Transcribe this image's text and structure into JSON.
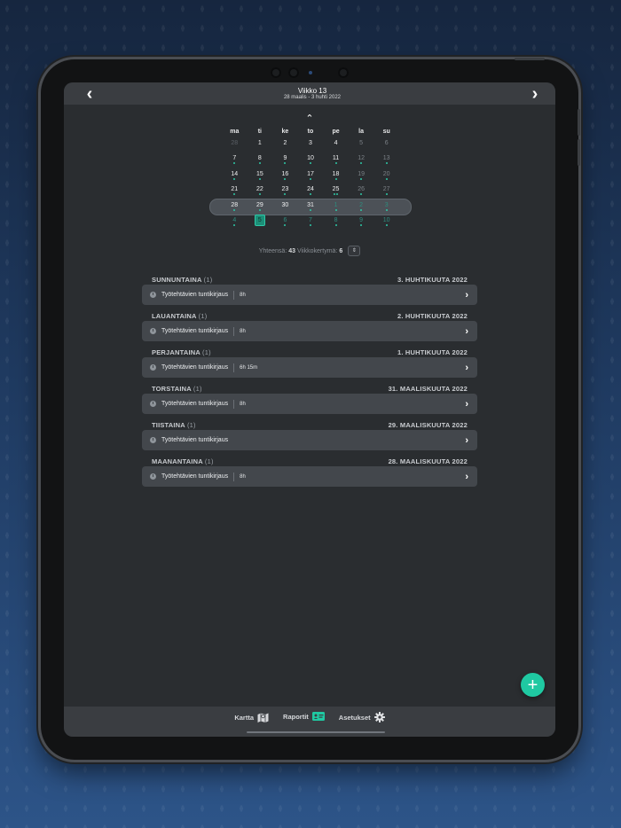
{
  "header": {
    "prev_icon": "chevron-left-icon",
    "next_icon": "chevron-right-icon",
    "prev_glyph": "‹",
    "next_glyph": "›",
    "week_title": "Viikko 13",
    "date_range": "28 maalis - 3 huhti 2022"
  },
  "calendar": {
    "collapse_glyph": "⌃",
    "weekdays": [
      "ma",
      "ti",
      "ke",
      "to",
      "pe",
      "la",
      "su"
    ],
    "weeks": [
      {
        "selected": false,
        "days": [
          {
            "d": "28",
            "s": "faded",
            "dots": 0
          },
          {
            "d": "1",
            "s": "",
            "dots": 0
          },
          {
            "d": "2",
            "s": "",
            "dots": 0
          },
          {
            "d": "3",
            "s": "",
            "dots": 0
          },
          {
            "d": "4",
            "s": "",
            "dots": 0
          },
          {
            "d": "5",
            "s": "weekend",
            "dots": 0
          },
          {
            "d": "6",
            "s": "weekend",
            "dots": 0
          }
        ]
      },
      {
        "selected": false,
        "days": [
          {
            "d": "7",
            "s": "",
            "dots": 1
          },
          {
            "d": "8",
            "s": "",
            "dots": 1
          },
          {
            "d": "9",
            "s": "",
            "dots": 1
          },
          {
            "d": "10",
            "s": "",
            "dots": 1
          },
          {
            "d": "11",
            "s": "",
            "dots": 1
          },
          {
            "d": "12",
            "s": "weekend",
            "dots": 1
          },
          {
            "d": "13",
            "s": "weekend",
            "dots": 1
          }
        ]
      },
      {
        "selected": false,
        "days": [
          {
            "d": "14",
            "s": "",
            "dots": 1
          },
          {
            "d": "15",
            "s": "",
            "dots": 1
          },
          {
            "d": "16",
            "s": "",
            "dots": 1
          },
          {
            "d": "17",
            "s": "",
            "dots": 1
          },
          {
            "d": "18",
            "s": "",
            "dots": 1
          },
          {
            "d": "19",
            "s": "weekend",
            "dots": 1
          },
          {
            "d": "20",
            "s": "weekend",
            "dots": 1
          }
        ]
      },
      {
        "selected": false,
        "days": [
          {
            "d": "21",
            "s": "",
            "dots": 1
          },
          {
            "d": "22",
            "s": "",
            "dots": 1
          },
          {
            "d": "23",
            "s": "",
            "dots": 1
          },
          {
            "d": "24",
            "s": "",
            "dots": 1
          },
          {
            "d": "25",
            "s": "",
            "dots": 2
          },
          {
            "d": "26",
            "s": "weekend",
            "dots": 1
          },
          {
            "d": "27",
            "s": "weekend",
            "dots": 1
          }
        ]
      },
      {
        "selected": true,
        "days": [
          {
            "d": "28",
            "s": "",
            "dots": 1
          },
          {
            "d": "29",
            "s": "",
            "dots": 1
          },
          {
            "d": "30",
            "s": "",
            "dots": 0
          },
          {
            "d": "31",
            "s": "",
            "dots": 1
          },
          {
            "d": "1",
            "s": "faded-green",
            "dots": 1
          },
          {
            "d": "2",
            "s": "faded-green",
            "dots": 1
          },
          {
            "d": "3",
            "s": "faded-green",
            "dots": 1
          }
        ]
      },
      {
        "selected": false,
        "days": [
          {
            "d": "4",
            "s": "faded-green",
            "dots": 1
          },
          {
            "d": "5",
            "s": "today",
            "dots": 0
          },
          {
            "d": "6",
            "s": "faded-green",
            "dots": 1
          },
          {
            "d": "7",
            "s": "faded-green",
            "dots": 1
          },
          {
            "d": "8",
            "s": "faded-green",
            "dots": 1
          },
          {
            "d": "9",
            "s": "faded-green",
            "dots": 1
          },
          {
            "d": "10",
            "s": "faded-green",
            "dots": 1
          }
        ]
      }
    ]
  },
  "totals": {
    "label_total": "Yhteensä:",
    "value_total": "43",
    "label_week": "Viikkokertymä:",
    "value_week": "6",
    "sort_glyph": "⇕"
  },
  "entry_icon": "clock-icon",
  "groups": [
    {
      "day": "SUNNUNTAINA",
      "count": "(1)",
      "date": "3. HUHTIKUUTA 2022",
      "entry": "Työtehtävien tuntikirjaus",
      "duration": "8h"
    },
    {
      "day": "LAUANTAINA",
      "count": "(1)",
      "date": "2. HUHTIKUUTA 2022",
      "entry": "Työtehtävien tuntikirjaus",
      "duration": "8h"
    },
    {
      "day": "PERJANTAINA",
      "count": "(1)",
      "date": "1. HUHTIKUUTA 2022",
      "entry": "Työtehtävien tuntikirjaus",
      "duration": "6h 15m"
    },
    {
      "day": "TORSTAINA",
      "count": "(1)",
      "date": "31. MAALISKUUTA 2022",
      "entry": "Työtehtävien tuntikirjaus",
      "duration": "8h"
    },
    {
      "day": "TIISTAINA",
      "count": "(1)",
      "date": "29. MAALISKUUTA 2022",
      "entry": "Työtehtävien tuntikirjaus",
      "duration": ""
    },
    {
      "day": "MAANANTAINA",
      "count": "(1)",
      "date": "28. MAALISKUUTA 2022",
      "entry": "Työtehtävien tuntikirjaus",
      "duration": "8h"
    }
  ],
  "fab": {
    "glyph": "+",
    "icon": "plus-icon"
  },
  "tabs": [
    {
      "label": "Kartta",
      "icon": "map-icon",
      "color": "#d6d8db"
    },
    {
      "label": "Raportit",
      "icon": "report-card-icon",
      "color": "#1fc9a2"
    },
    {
      "label": "Asetukset",
      "icon": "gear-icon",
      "color": "#e2e4e6"
    }
  ]
}
